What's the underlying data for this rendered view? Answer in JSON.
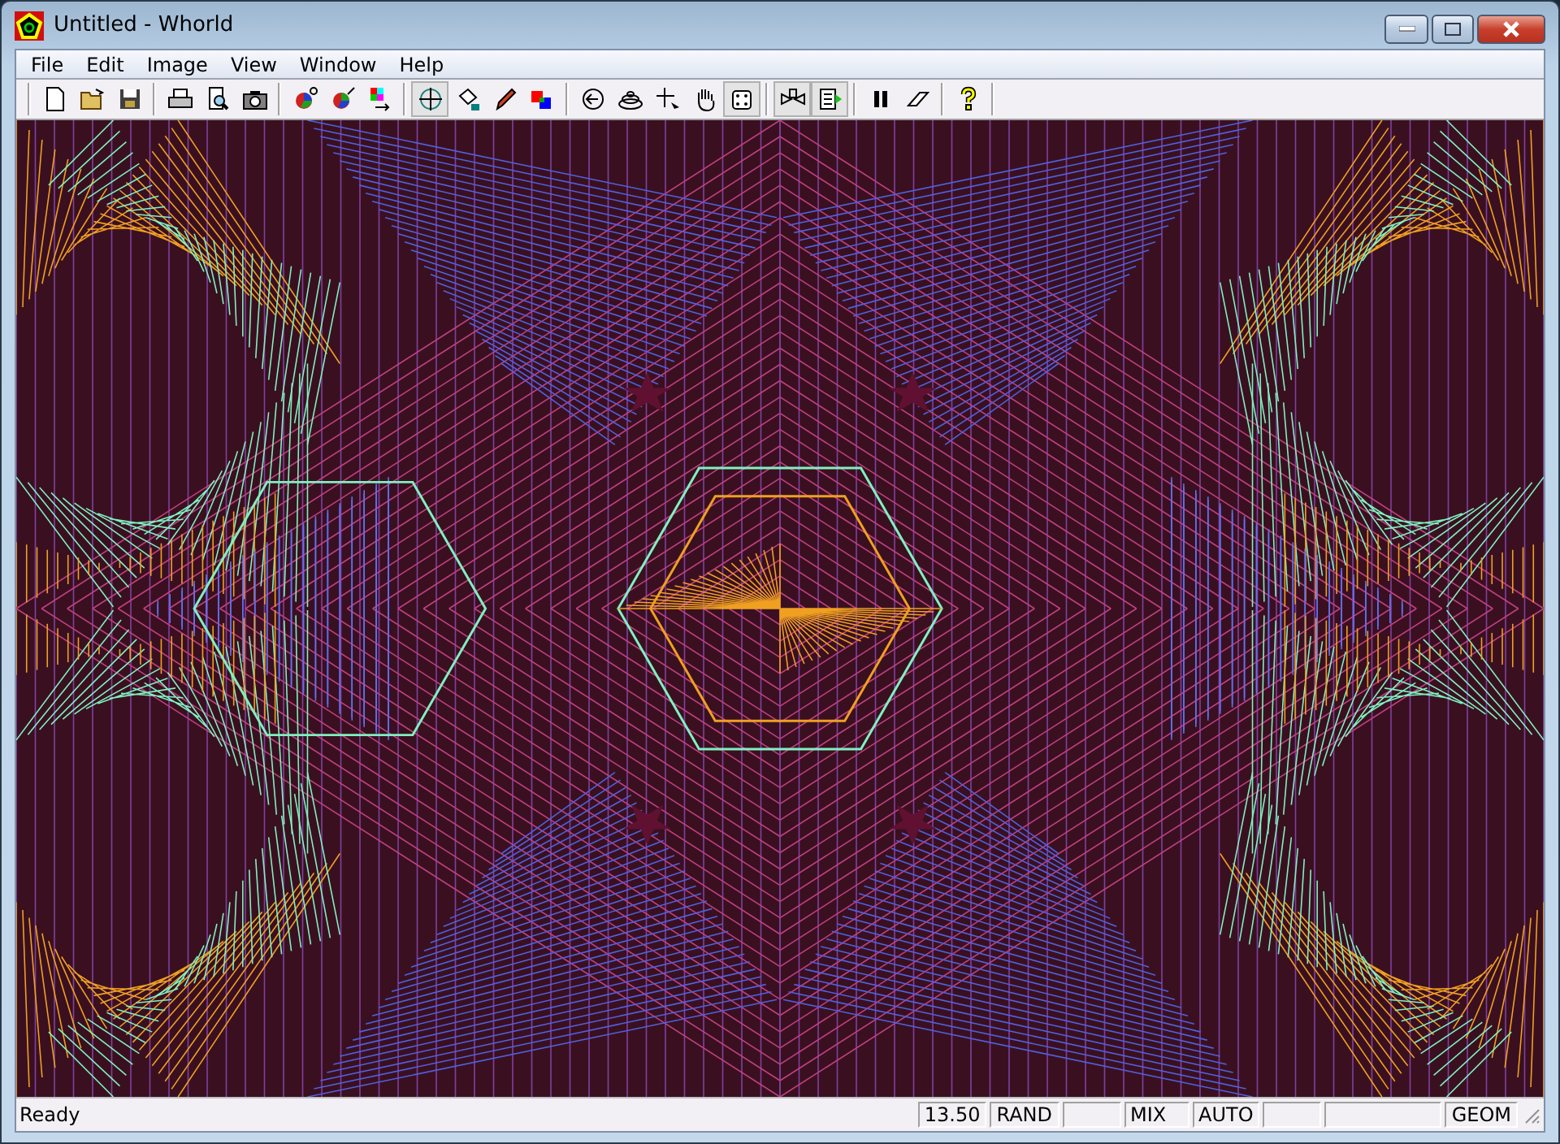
{
  "window": {
    "title": "Untitled - Whorld"
  },
  "menu": [
    "File",
    "Edit",
    "Image",
    "View",
    "Window",
    "Help"
  ],
  "toolbar": [
    [
      {
        "pressed": false
      },
      {
        "pressed": false
      },
      {
        "pressed": false
      }
    ],
    [
      {
        "pressed": false
      },
      {
        "pressed": false
      },
      {
        "pressed": false
      }
    ],
    [
      {
        "pressed": false
      },
      {
        "pressed": false
      },
      {
        "pressed": false
      }
    ],
    [
      {
        "pressed": true
      },
      {
        "pressed": false
      },
      {
        "pressed": false
      },
      {
        "pressed": false
      }
    ],
    [
      {
        "pressed": false
      },
      {
        "pressed": false
      },
      {
        "pressed": false
      },
      {
        "pressed": false
      },
      {
        "pressed": true
      }
    ],
    [
      {
        "pressed": true
      },
      {
        "pressed": true
      }
    ],
    [
      {
        "pressed": false
      },
      {
        "pressed": false
      }
    ],
    [
      {
        "pressed": false
      }
    ]
  ],
  "status_bar": {
    "message": "Ready",
    "panels": [
      {
        "kind": "text",
        "text": "13.50"
      },
      {
        "kind": "text",
        "text": "RAND"
      },
      {
        "kind": "empty"
      },
      {
        "kind": "text",
        "text": "MIX"
      },
      {
        "kind": "text",
        "text": "AUTO"
      },
      {
        "kind": "empty"
      },
      {
        "kind": "empty"
      },
      {
        "kind": "text",
        "text": "GEOM"
      }
    ]
  }
}
